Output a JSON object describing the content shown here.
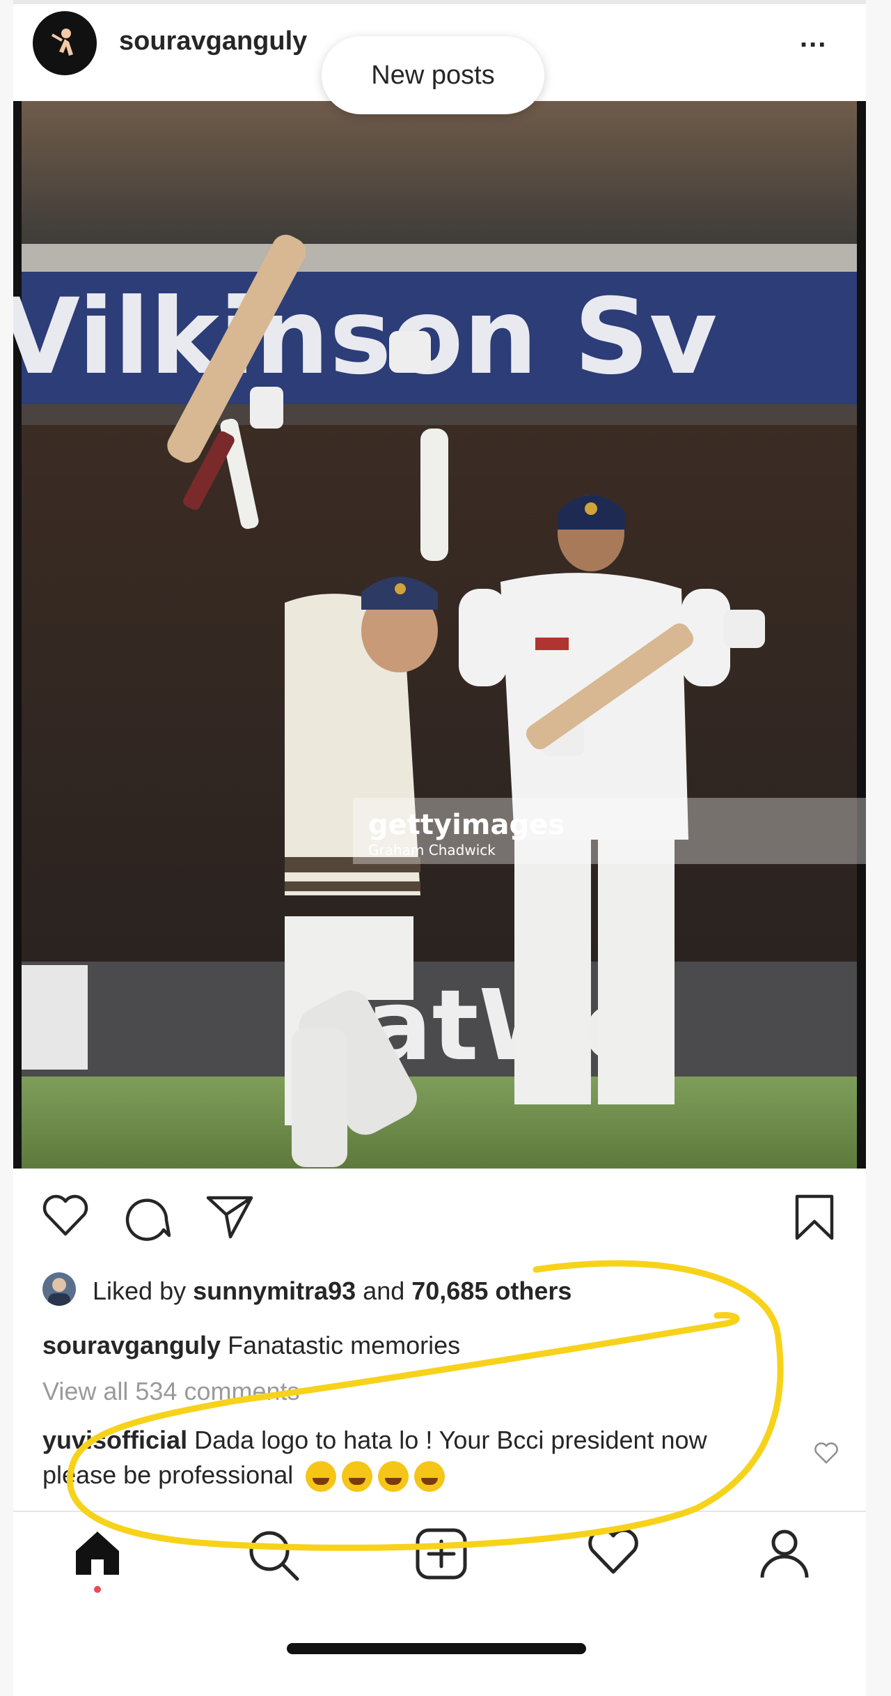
{
  "post": {
    "username": "souravganguly",
    "more_label": "...",
    "new_posts_label": "New posts",
    "photo": {
      "banner_text": "Vilkinson Sv",
      "watermark_brand": "gettyimages",
      "watermark_credit": "Graham Chadwick",
      "sponsor_text": "NatWe"
    },
    "likes": {
      "prefix": "Liked by ",
      "user": "sunnymitra93",
      "middle": " and ",
      "count": "70,685 others"
    },
    "caption": {
      "user": "souravganguly",
      "text": " Fanatastic memories"
    },
    "view_all_comments": "View all 534 comments",
    "comment": {
      "user": "yuvisofficial",
      "text": " Dada logo to hata lo ! Your Bcci president now please be professional",
      "emojis": [
        "rofl",
        "zany-face",
        "zany-face",
        "grinning-face"
      ]
    }
  },
  "colors": {
    "annotation": "#f7d21a",
    "notification_dot": "#ed4956",
    "text": "#262626",
    "muted": "#9a9a9a"
  },
  "nav": {
    "items": [
      "home-icon",
      "search-icon",
      "new-post-icon",
      "activity-heart-icon",
      "profile-icon"
    ]
  }
}
